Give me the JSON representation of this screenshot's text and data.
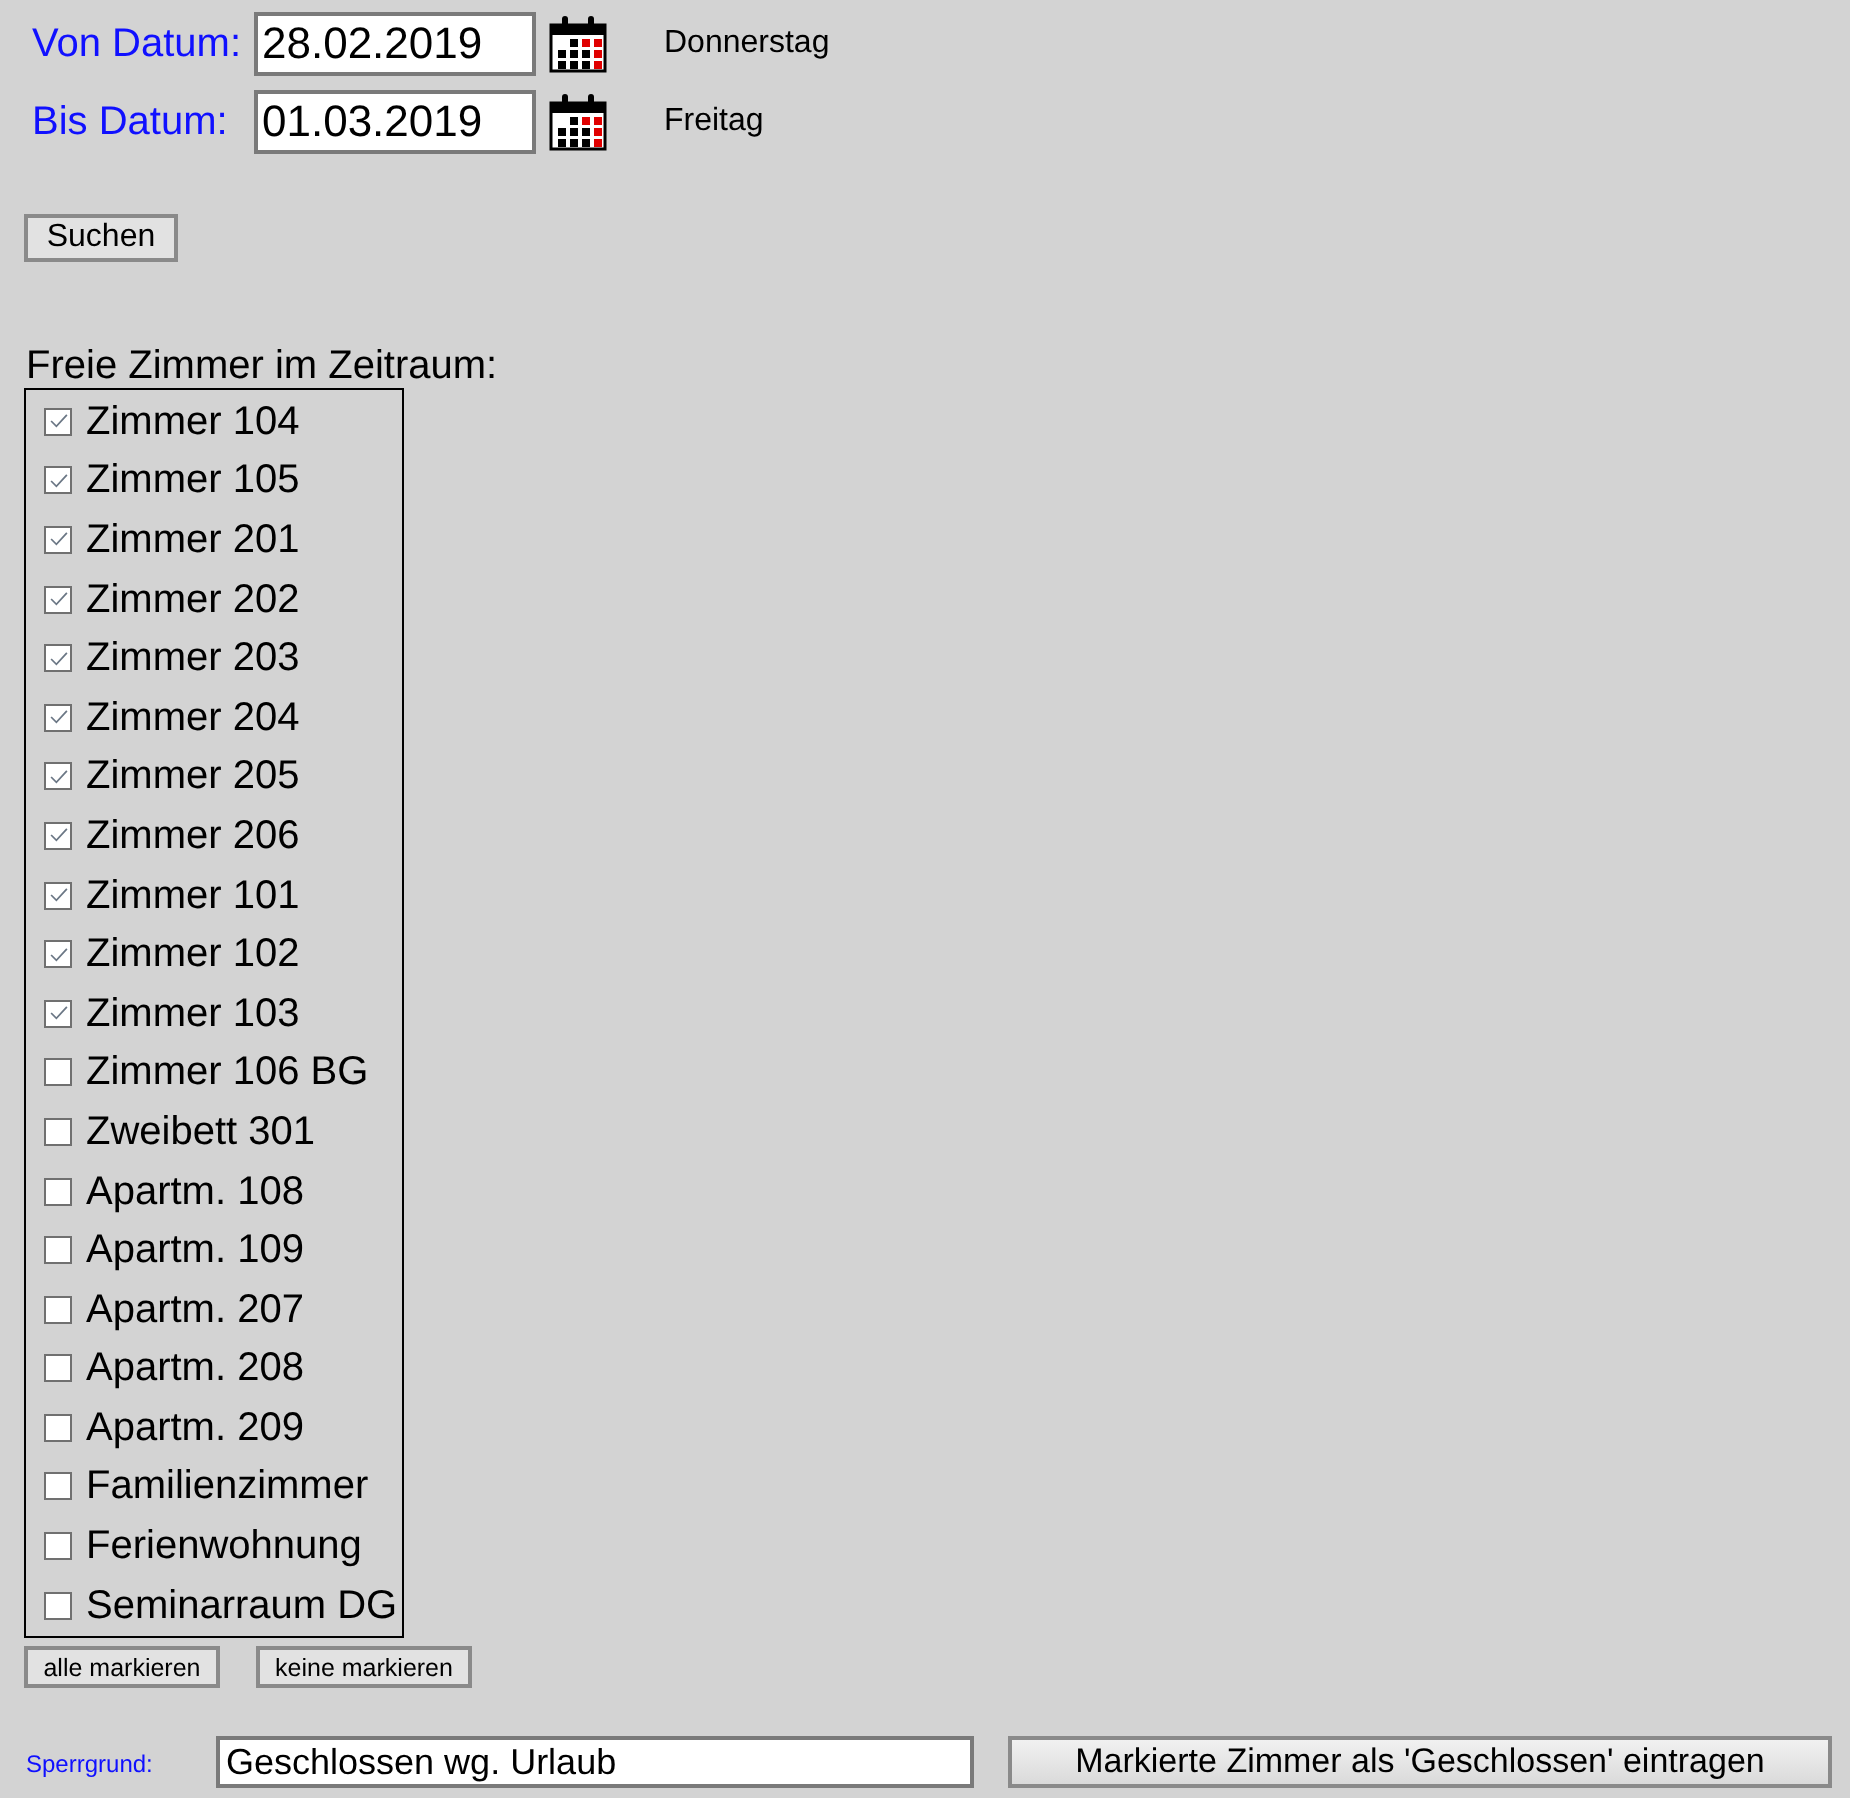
{
  "date_range": [
    {
      "label": "Von Datum:",
      "value": "28.02.2019",
      "weekday": "Donnerstag"
    },
    {
      "label": "Bis Datum:",
      "value": "01.03.2019",
      "weekday": "Freitag"
    }
  ],
  "search_button": "Suchen",
  "rooms": {
    "heading": "Freie Zimmer im Zeitraum:",
    "items": [
      {
        "label": "Zimmer 104",
        "checked": true
      },
      {
        "label": "Zimmer 105",
        "checked": true
      },
      {
        "label": "Zimmer 201",
        "checked": true
      },
      {
        "label": "Zimmer 202",
        "checked": true
      },
      {
        "label": "Zimmer 203",
        "checked": true
      },
      {
        "label": "Zimmer 204",
        "checked": true
      },
      {
        "label": "Zimmer 205",
        "checked": true
      },
      {
        "label": "Zimmer 206",
        "checked": true
      },
      {
        "label": "Zimmer 101",
        "checked": true
      },
      {
        "label": "Zimmer 102",
        "checked": true
      },
      {
        "label": "Zimmer 103",
        "checked": true
      },
      {
        "label": "Zimmer 106 BG",
        "checked": false
      },
      {
        "label": "Zweibett 301",
        "checked": false
      },
      {
        "label": "Apartm. 108",
        "checked": false
      },
      {
        "label": "Apartm. 109",
        "checked": false
      },
      {
        "label": "Apartm. 207",
        "checked": false
      },
      {
        "label": "Apartm. 208",
        "checked": false
      },
      {
        "label": "Apartm. 209",
        "checked": false
      },
      {
        "label": "Familienzimmer",
        "checked": false
      },
      {
        "label": "Ferienwohnung",
        "checked": false
      },
      {
        "label": "Seminarraum DG",
        "checked": false
      }
    ]
  },
  "selection_buttons": [
    "alle markieren",
    "keine markieren"
  ],
  "block_reason": {
    "label": "Sperrgrund:",
    "value": "Geschlossen wg. Urlaub"
  },
  "submit_button": "Markierte Zimmer als 'Geschlossen' eintragen"
}
